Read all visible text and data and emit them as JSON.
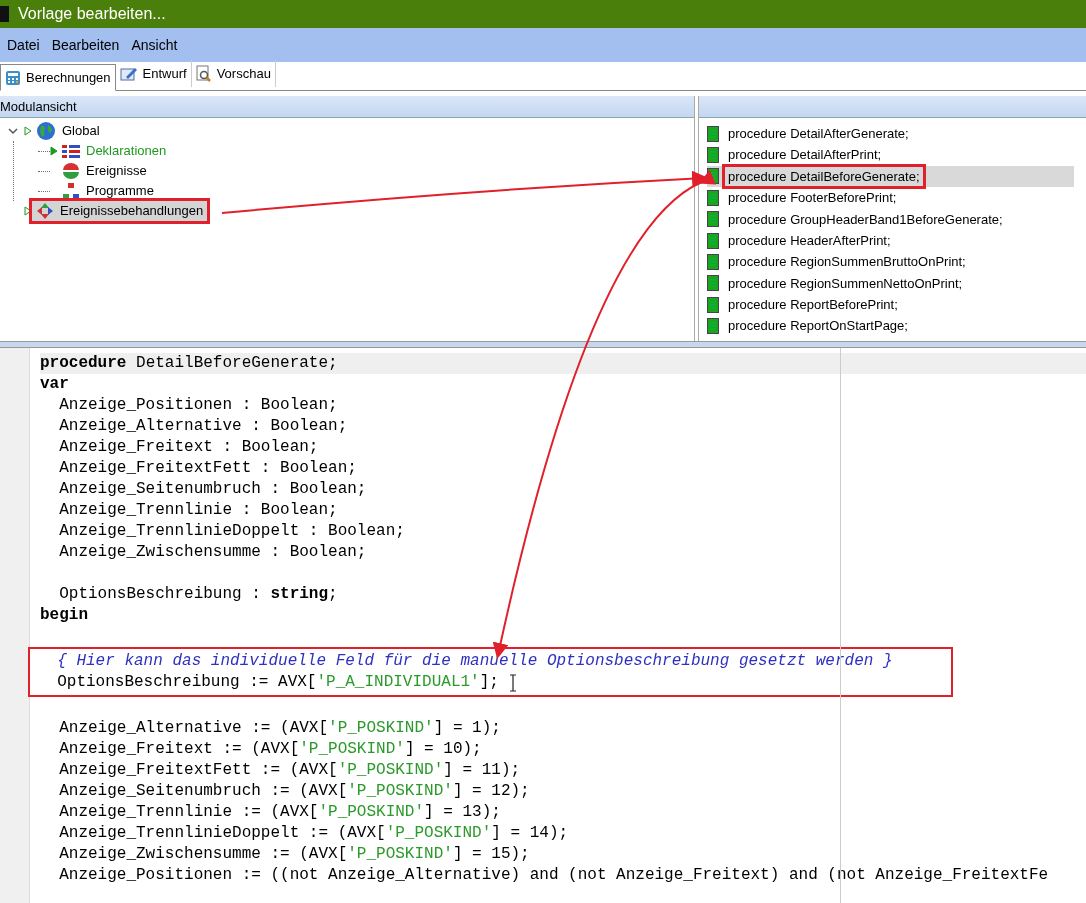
{
  "window": {
    "title": "Vorlage bearbeiten..."
  },
  "menu": [
    "Datei",
    "Bearbeiten",
    "Ansicht"
  ],
  "tabs": [
    {
      "label": "Berechnungen",
      "selected": true,
      "kind": "calc"
    },
    {
      "label": "Entwurf",
      "selected": false,
      "kind": "design"
    },
    {
      "label": "Vorschau",
      "selected": false,
      "kind": "preview"
    }
  ],
  "module_view": {
    "title": "Modulansicht",
    "tree": [
      {
        "label": "Global",
        "kind": "globe",
        "color": "#000000",
        "expanded": true,
        "selected": false,
        "framed": false,
        "children": [
          {
            "label": "Deklarationen",
            "kind": "grid",
            "color": "#1f9a1f",
            "selected": false,
            "framed": false
          },
          {
            "label": "Ereignisse",
            "kind": "events",
            "color": "#000000",
            "selected": false,
            "framed": false
          },
          {
            "label": "Programme",
            "kind": "programs",
            "color": "#000000",
            "selected": false,
            "framed": false
          }
        ]
      },
      {
        "label": "Ereignissebehandlungen",
        "kind": "handlers",
        "color": "#000000",
        "selected": true,
        "framed": true
      }
    ]
  },
  "procedures": [
    {
      "label": "procedure DetailAfterGenerate;",
      "selected": false,
      "framed": false
    },
    {
      "label": "procedure DetailAfterPrint;",
      "selected": false,
      "framed": false
    },
    {
      "label": "procedure DetailBeforeGenerate;",
      "selected": true,
      "framed": true
    },
    {
      "label": "procedure FooterBeforePrint;",
      "selected": false,
      "framed": false
    },
    {
      "label": "procedure GroupHeaderBand1BeforeGenerate;",
      "selected": false,
      "framed": false
    },
    {
      "label": "procedure HeaderAfterPrint;",
      "selected": false,
      "framed": false
    },
    {
      "label": "procedure RegionSummenBruttoOnPrint;",
      "selected": false,
      "framed": false
    },
    {
      "label": "procedure RegionSummenNettoOnPrint;",
      "selected": false,
      "framed": false
    },
    {
      "label": "procedure ReportBeforePrint;",
      "selected": false,
      "framed": false
    },
    {
      "label": "procedure ReportOnStartPage;",
      "selected": false,
      "framed": false
    }
  ],
  "code": [
    {
      "current": true,
      "framed": false,
      "tokens": [
        {
          "kind": "kw",
          "text": "procedure"
        },
        {
          "kind": "text",
          "text": " DetailBeforeGenerate;"
        }
      ]
    },
    {
      "current": false,
      "framed": false,
      "tokens": [
        {
          "kind": "kw",
          "text": "var"
        }
      ]
    },
    {
      "current": false,
      "framed": false,
      "tokens": [
        {
          "kind": "text",
          "text": "  Anzeige_Positionen : Boolean;"
        }
      ]
    },
    {
      "current": false,
      "framed": false,
      "tokens": [
        {
          "kind": "text",
          "text": "  Anzeige_Alternative : Boolean;"
        }
      ]
    },
    {
      "current": false,
      "framed": false,
      "tokens": [
        {
          "kind": "text",
          "text": "  Anzeige_Freitext : Boolean;"
        }
      ]
    },
    {
      "current": false,
      "framed": false,
      "tokens": [
        {
          "kind": "text",
          "text": "  Anzeige_FreitextFett : Boolean;"
        }
      ]
    },
    {
      "current": false,
      "framed": false,
      "tokens": [
        {
          "kind": "text",
          "text": "  Anzeige_Seitenumbruch : Boolean;"
        }
      ]
    },
    {
      "current": false,
      "framed": false,
      "tokens": [
        {
          "kind": "text",
          "text": "  Anzeige_Trennlinie : Boolean;"
        }
      ]
    },
    {
      "current": false,
      "framed": false,
      "tokens": [
        {
          "kind": "text",
          "text": "  Anzeige_TrennlinieDoppelt : Boolean;"
        }
      ]
    },
    {
      "current": false,
      "framed": false,
      "tokens": [
        {
          "kind": "text",
          "text": "  Anzeige_Zwischensumme : Boolean;"
        }
      ]
    },
    {
      "current": false,
      "framed": false
    },
    {
      "current": false,
      "framed": false,
      "tokens": [
        {
          "kind": "text",
          "text": "  OptionsBeschreibung : "
        },
        {
          "kind": "kw",
          "text": "string"
        },
        {
          "kind": "text",
          "text": ";"
        }
      ]
    },
    {
      "current": false,
      "framed": false,
      "tokens": [
        {
          "kind": "kw",
          "text": "begin"
        }
      ]
    },
    {
      "current": false,
      "framed": false
    },
    {
      "current": false,
      "framed": true,
      "tokens": [
        {
          "kind": "comment",
          "text": "  { Hier kann das individuelle Feld für die manuelle Optionsbeschreibung gesetzt werden }"
        }
      ]
    },
    {
      "current": false,
      "framed": true,
      "cursor": true,
      "tokens": [
        {
          "kind": "text",
          "text": "  OptionsBeschreibung := AVX["
        },
        {
          "kind": "str",
          "text": "'P_A_INDIVIDUAL1'"
        },
        {
          "kind": "text",
          "text": "];"
        }
      ]
    },
    {
      "current": false,
      "framed": false
    },
    {
      "current": false,
      "framed": false,
      "tokens": [
        {
          "kind": "text",
          "text": "  Anzeige_Alternative := (AVX["
        },
        {
          "kind": "str",
          "text": "'P_POSKIND'"
        },
        {
          "kind": "text",
          "text": "] = 1);"
        }
      ]
    },
    {
      "current": false,
      "framed": false,
      "tokens": [
        {
          "kind": "text",
          "text": "  Anzeige_Freitext := (AVX["
        },
        {
          "kind": "str",
          "text": "'P_POSKIND'"
        },
        {
          "kind": "text",
          "text": "] = 10);"
        }
      ]
    },
    {
      "current": false,
      "framed": false,
      "tokens": [
        {
          "kind": "text",
          "text": "  Anzeige_FreitextFett := (AVX["
        },
        {
          "kind": "str",
          "text": "'P_POSKIND'"
        },
        {
          "kind": "text",
          "text": "] = 11);"
        }
      ]
    },
    {
      "current": false,
      "framed": false,
      "tokens": [
        {
          "kind": "text",
          "text": "  Anzeige_Seitenumbruch := (AVX["
        },
        {
          "kind": "str",
          "text": "'P_POSKIND'"
        },
        {
          "kind": "text",
          "text": "] = 12);"
        }
      ]
    },
    {
      "current": false,
      "framed": false,
      "tokens": [
        {
          "kind": "text",
          "text": "  Anzeige_Trennlinie := (AVX["
        },
        {
          "kind": "str",
          "text": "'P_POSKIND'"
        },
        {
          "kind": "text",
          "text": "] = 13);"
        }
      ]
    },
    {
      "current": false,
      "framed": false,
      "tokens": [
        {
          "kind": "text",
          "text": "  Anzeige_TrennlinieDoppelt := (AVX["
        },
        {
          "kind": "str",
          "text": "'P_POSKIND'"
        },
        {
          "kind": "text",
          "text": "] = 14);"
        }
      ]
    },
    {
      "current": false,
      "framed": false,
      "tokens": [
        {
          "kind": "text",
          "text": "  Anzeige_Zwischensumme := (AVX["
        },
        {
          "kind": "str",
          "text": "'P_POSKIND'"
        },
        {
          "kind": "text",
          "text": "] = 15);"
        }
      ]
    },
    {
      "current": false,
      "framed": false,
      "tokens": [
        {
          "kind": "text",
          "text": "  Anzeige_Positionen := ((not Anzeige_Alternative) and (not Anzeige_Freitext) and (not Anzeige_FreitextFe"
        }
      ]
    }
  ]
}
